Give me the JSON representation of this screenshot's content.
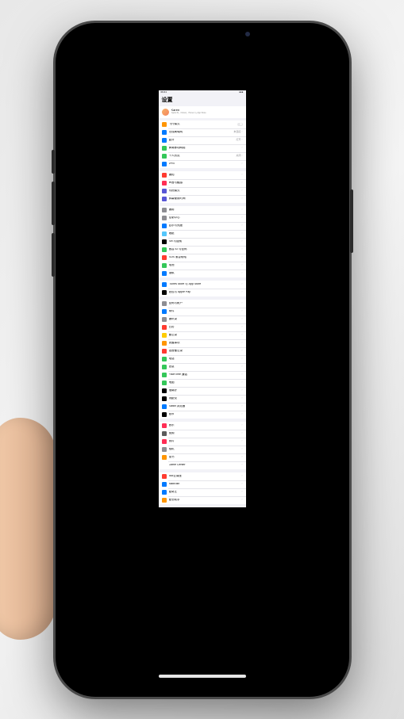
{
  "statusbar": {
    "time": "09:41"
  },
  "page_title": "设置",
  "profile": {
    "name": "Karen",
    "subtitle": "Apple ID、iCloud、iTunes 与 App Store"
  },
  "groups": [
    [
      {
        "icon": "airplane-icon",
        "color": "#ff9500",
        "label": "飞行模式",
        "kind": "toggle"
      },
      {
        "icon": "wifi-icon",
        "color": "#007aff",
        "label": "无线局域网",
        "value": "未连接"
      },
      {
        "icon": "bluetooth-icon",
        "color": "#007aff",
        "label": "蓝牙",
        "value": "打开"
      },
      {
        "icon": "cellular-icon",
        "color": "#34c759",
        "label": "蜂窝移动网络"
      },
      {
        "icon": "hotspot-icon",
        "color": "#34c759",
        "label": "个人热点",
        "value": "关闭"
      },
      {
        "icon": "vpn-icon",
        "color": "#007aff",
        "label": "VPN"
      }
    ],
    [
      {
        "icon": "notification-icon",
        "color": "#ff3b30",
        "label": "通知"
      },
      {
        "icon": "sound-icon",
        "color": "#ff2d55",
        "label": "声音与触感"
      },
      {
        "icon": "dnd-icon",
        "color": "#5856d6",
        "label": "勿扰模式"
      },
      {
        "icon": "screentime-icon",
        "color": "#5856d6",
        "label": "屏幕使用时间"
      }
    ],
    [
      {
        "icon": "general-icon",
        "color": "#8e8e93",
        "label": "通用"
      },
      {
        "icon": "control-center-icon",
        "color": "#8e8e93",
        "label": "控制中心"
      },
      {
        "icon": "display-icon",
        "color": "#007aff",
        "label": "显示与亮度"
      },
      {
        "icon": "wallpaper-icon",
        "color": "#54c7fc",
        "label": "墙纸"
      },
      {
        "icon": "siri-icon",
        "color": "#000000",
        "label": "Siri 与搜索"
      },
      {
        "icon": "faceid-icon",
        "color": "#34c759",
        "label": "面容 ID 与密码"
      },
      {
        "icon": "sos-icon",
        "color": "#ff3b30",
        "label": "SOS 紧急联络"
      },
      {
        "icon": "battery-icon",
        "color": "#34c759",
        "label": "电池"
      },
      {
        "icon": "privacy-icon",
        "color": "#007aff",
        "label": "隐私"
      }
    ],
    [
      {
        "icon": "appstore-icon",
        "color": "#007aff",
        "label": "iTunes Store 与 App Store"
      },
      {
        "icon": "wallet-icon",
        "color": "#000000",
        "label": "钱包与 Apple Pay"
      }
    ],
    [
      {
        "icon": "passwords-icon",
        "color": "#8e8e93",
        "label": "密码与帐户"
      },
      {
        "icon": "mail-icon",
        "color": "#007aff",
        "label": "邮件"
      },
      {
        "icon": "contacts-icon",
        "color": "#8e8e93",
        "label": "通讯录"
      },
      {
        "icon": "calendar-icon",
        "color": "#ff3b30",
        "label": "日历"
      },
      {
        "icon": "notes-icon",
        "color": "#ffcc00",
        "label": "备忘录"
      },
      {
        "icon": "reminders-icon",
        "color": "#ff9500",
        "label": "提醒事项"
      },
      {
        "icon": "voicememo-icon",
        "color": "#ff3b30",
        "label": "语音备忘录"
      },
      {
        "icon": "phone-icon",
        "color": "#34c759",
        "label": "电话"
      },
      {
        "icon": "messages-icon",
        "color": "#34c759",
        "label": "信息"
      },
      {
        "icon": "facetime-icon",
        "color": "#34c759",
        "label": "FaceTime 通话"
      },
      {
        "icon": "maps-icon",
        "color": "#34c759",
        "label": "地图"
      },
      {
        "icon": "compass-icon",
        "color": "#000000",
        "label": "指南针"
      },
      {
        "icon": "measure-icon",
        "color": "#000000",
        "label": "测距仪"
      },
      {
        "icon": "safari-icon",
        "color": "#007aff",
        "label": "Safari 浏览器"
      },
      {
        "icon": "stocks-icon",
        "color": "#000000",
        "label": "股市"
      }
    ],
    [
      {
        "icon": "music-icon",
        "color": "#ff2d55",
        "label": "音乐"
      },
      {
        "icon": "video-icon",
        "color": "#5c5c5c",
        "label": "视频"
      },
      {
        "icon": "photos-icon",
        "color": "#ff2d55",
        "label": "照片"
      },
      {
        "icon": "camera-icon",
        "color": "#8e8e93",
        "label": "相机"
      },
      {
        "icon": "books-icon",
        "color": "#ff9500",
        "label": "图书"
      },
      {
        "icon": "gamecenter-icon",
        "color": "#ffffff",
        "label": "Game Center"
      }
    ],
    [
      {
        "icon": "app-icon-1",
        "color": "#ff3b30",
        "label": "365云课堂"
      },
      {
        "icon": "app-icon-2",
        "color": "#007aff",
        "label": "ABBrush"
      },
      {
        "icon": "app-icon-3",
        "color": "#007aff",
        "label": "爱奇艺"
      },
      {
        "icon": "app-icon-4",
        "color": "#ff9500",
        "label": "爱思助手"
      }
    ]
  ]
}
